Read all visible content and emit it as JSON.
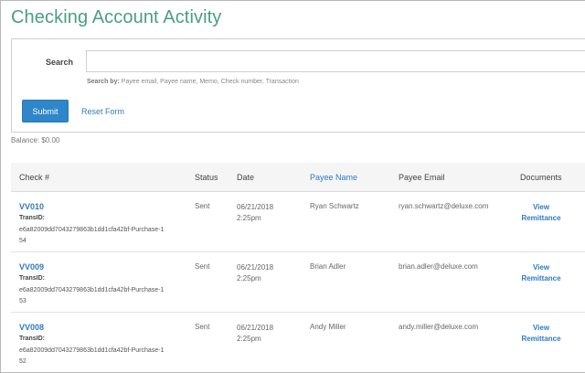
{
  "page": {
    "title": "Checking Account Activity"
  },
  "search": {
    "label": "Search",
    "value": "",
    "placeholder": "",
    "hint_prefix": "Search by:",
    "hint_text": "Payee email, Payee name, Memo, Check number, Transaction",
    "submit_label": "Submit",
    "reset_label": "Reset Form"
  },
  "balance": {
    "text": "Balance: $0.00"
  },
  "table": {
    "headers": {
      "check": "Check #",
      "status": "Status",
      "date": "Date",
      "payee_name": "Payee Name",
      "payee_email": "Payee Email",
      "documents": "Documents"
    },
    "trans_label": "TransID:",
    "rows": [
      {
        "check": "VV010",
        "trans_id": "e6a82009dd7043279863b1dd1cfa42bf-Purchase-154",
        "status": "Sent",
        "date": "06/21/2018",
        "time": "2:25pm",
        "payee_name": "Ryan Schwartz",
        "payee_email": "ryan.schwartz@deluxe.com",
        "doc_line1": "View",
        "doc_line2": "Remittance"
      },
      {
        "check": "VV009",
        "trans_id": "e6a82009dd7043279863b1dd1cfa42bf-Purchase-153",
        "status": "Sent",
        "date": "06/21/2018",
        "time": "2:25pm",
        "payee_name": "Brian Adler",
        "payee_email": "brian.adler@deluxe.com",
        "doc_line1": "View",
        "doc_line2": "Remittance"
      },
      {
        "check": "VV008",
        "trans_id": "e6a82009dd7043279863b1dd1cfa42bf-Purchase-152",
        "status": "Sent",
        "date": "06/21/2018",
        "time": "2:25pm",
        "payee_name": "Andy Miller",
        "payee_email": "andy.miller@deluxe.com",
        "doc_line1": "View",
        "doc_line2": "Remittance"
      }
    ]
  },
  "colors": {
    "title": "#4a9e84",
    "accent": "#2f86c9",
    "link": "#2e7cc0"
  }
}
